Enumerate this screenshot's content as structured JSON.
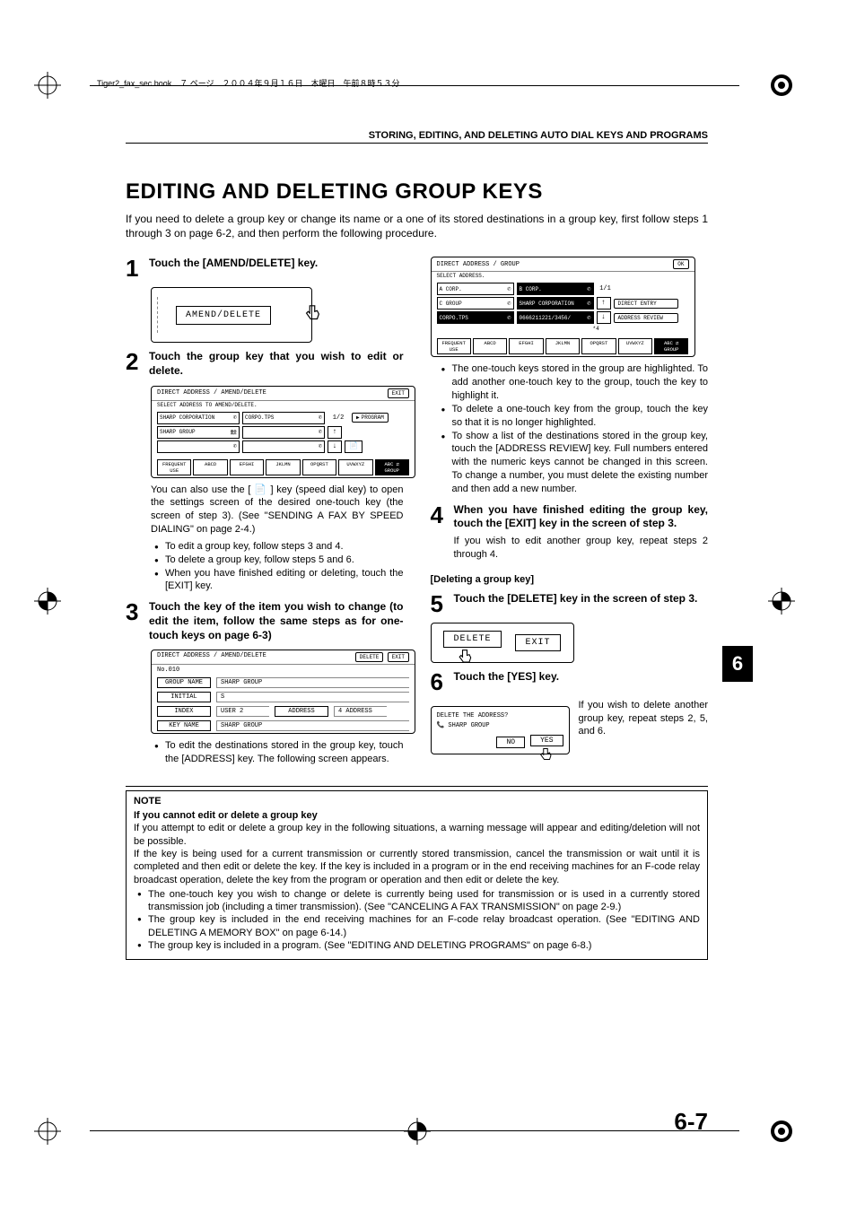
{
  "meta": {
    "header_line": "Tiger2_fax_sec.book　７ ページ　２００４年９月１６日　木曜日　午前８時５３分"
  },
  "breadcrumb": "STORING, EDITING, AND DELETING AUTO DIAL KEYS AND PROGRAMS",
  "heading": "EDITING AND DELETING GROUP KEYS",
  "intro": "If you need to delete a group key or change its name or a one of its stored destinations in a group key, first follow steps 1 through 3 on page 6-2, and then perform the following procedure.",
  "steps": {
    "s1": {
      "num": "1",
      "title": "Touch the [AMEND/DELETE] key.",
      "button": "AMEND/DELETE"
    },
    "s2": {
      "num": "2",
      "title": "Touch the group key that you wish to edit or delete.",
      "panel": {
        "title": "DIRECT ADDRESS / AMEND/DELETE",
        "exit": "EXIT",
        "sub": "SELECT ADDRESS TO AMEND/DELETE.",
        "cells": [
          "SHARP CORPORATION",
          "CORPO.TPS",
          "SHARP GROUP"
        ],
        "page": "1/2",
        "program": "PROGRAM",
        "tabs": [
          "FREQUENT USE",
          "ABCD",
          "EFGHI",
          "JKLMN",
          "OPQRST",
          "UVWXYZ"
        ],
        "tab_right_a": "ABC",
        "tab_right_b": "GROUP"
      },
      "body": "You can also use the [ 📄 ] key (speed dial key) to open the settings screen of the desired one-touch key (the screen of step 3). (See \"SENDING A FAX BY SPEED DIALING\" on page 2-4.)",
      "bul1": "To edit a group key, follow steps 3 and 4.",
      "bul2": "To delete a group key, follow steps 5 and 6.",
      "bul3": "When you have finished editing or deleting, touch the [EXIT] key."
    },
    "s3": {
      "num": "3",
      "title": "Touch the key of the item you wish to change (to edit the item, follow the same steps as for one-touch keys on page 6-3)",
      "panel": {
        "title": "DIRECT ADDRESS / AMEND/DELETE",
        "delete": "DELETE",
        "exit": "EXIT",
        "no": "No.010",
        "rows": {
          "group_name_l": "GROUP NAME",
          "group_name_v": "SHARP GROUP",
          "initial_l": "INITIAL",
          "initial_v": "S",
          "index_l": "INDEX",
          "index_v": "USER 2",
          "address_l": "ADDRESS",
          "address_v": "4 ADDRESS",
          "key_l": "KEY NAME",
          "key_v": "SHARP GROUP"
        }
      },
      "bul1": "To edit the destinations stored in the group key, touch the [ADDRESS] key. The following screen appears."
    },
    "right_panel": {
      "title": "DIRECT ADDRESS / GROUP",
      "ok": "OK",
      "sub": "SELECT ADDRESS.",
      "cells": {
        "a": "A CORP.",
        "b": "B CORP.",
        "c": "C GROUP",
        "d": "SHARP CORPORATION",
        "e": "CORPO.TPS",
        "f": "0666211221/3456/"
      },
      "page": "1/1",
      "star": "*4",
      "direct": "DIRECT ENTRY",
      "review": "ADDRESS REVIEW",
      "tabs": [
        "FREQUENT USE",
        "ABCD",
        "EFGHI",
        "JKLMN",
        "OPQRST",
        "UVWXYZ"
      ],
      "tab_right_a": "ABC",
      "tab_right_b": "GROUP",
      "bul1": "The one-touch keys stored in the group are highlighted. To add another one-touch key to the group, touch the key to highlight it.",
      "bul2": "To delete a one-touch key from the group, touch the key so that it is no longer highlighted.",
      "bul3": "To show a list of the destinations stored in the group key, touch the [ADDRESS REVIEW] key. Full numbers entered with the numeric keys cannot be changed in this screen. To change a number, you must delete the existing number and then add a new number."
    },
    "s4": {
      "num": "4",
      "title": "When you have finished editing the group key, touch the [EXIT] key in the screen of step 3.",
      "body": "If you wish to edit another group key, repeat steps 2 through 4."
    },
    "del_heading": "[Deleting a group key]",
    "s5": {
      "num": "5",
      "title": "Touch the [DELETE] key in the screen of step 3.",
      "b1": "DELETE",
      "b2": "EXIT"
    },
    "s6": {
      "num": "6",
      "title": "Touch the [YES] key.",
      "q": "DELETE THE ADDRESS?",
      "name": "SHARP GROUP",
      "no": "NO",
      "yes": "YES",
      "body": "If you wish to delete another group key, repeat steps 2, 5, and 6."
    }
  },
  "note": {
    "label": "NOTE",
    "sub": "If you cannot edit or delete a group key",
    "p1": "If you attempt to edit or delete a group key in the following situations, a warning message will appear and editing/deletion will not be possible.",
    "p2": "If the key is being used for a current transmission or currently stored transmission, cancel the transmission or wait until it is completed and then edit or delete the key. If the key is included in a program or in the end receiving machines for an F-code relay broadcast operation, delete the key from the program or operation and then edit or delete the key.",
    "b1": "The one-touch key you wish to change or delete is currently being used for transmission or is used in a currently stored transmission job (including a timer transmission). (See \"CANCELING A FAX TRANSMISSION\" on page 2-9.)",
    "b2": "The group key is included in the end receiving machines for an F-code relay broadcast operation. (See \"EDITING AND DELETING A MEMORY BOX\" on page 6-14.)",
    "b3": "The group key is included in a program. (See \"EDITING AND DELETING PROGRAMS\" on page 6-8.)"
  },
  "thumb": "6",
  "pagenum": "6-7"
}
